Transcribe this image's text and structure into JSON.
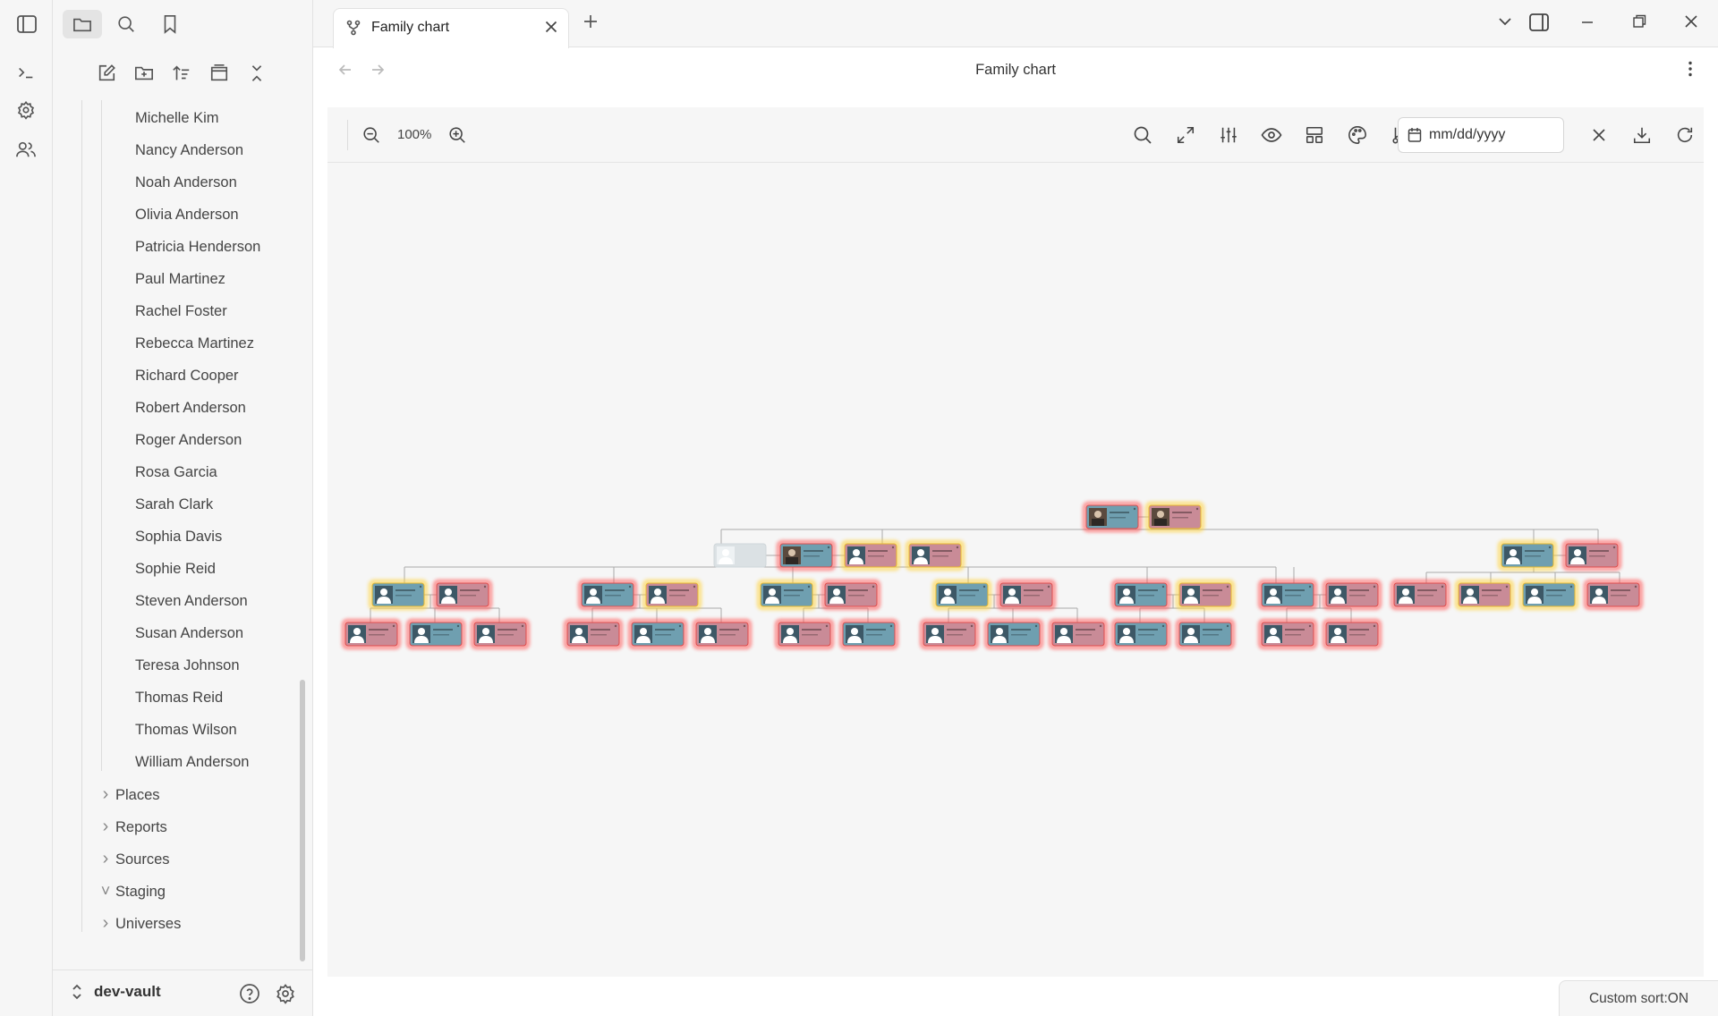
{
  "tab": {
    "title": "Family chart"
  },
  "view": {
    "title": "Family chart"
  },
  "toolbar": {
    "zoom": "100%",
    "date_placeholder": "mm/dd/yyyy"
  },
  "sidebar": {
    "people": [
      "Michelle Kim",
      "Nancy Anderson",
      "Noah Anderson",
      "Olivia Anderson",
      "Patricia Henderson",
      "Paul Martinez",
      "Rachel Foster",
      "Rebecca Martinez",
      "Richard Cooper",
      "Robert Anderson",
      "Roger Anderson",
      "Rosa Garcia",
      "Sarah Clark",
      "Sophia Davis",
      "Sophie Reid",
      "Steven Anderson",
      "Susan Anderson",
      "Teresa Johnson",
      "Thomas Reid",
      "Thomas Wilson",
      "William Anderson"
    ],
    "folders": [
      {
        "label": "Places",
        "expanded": false
      },
      {
        "label": "Reports",
        "expanded": false
      },
      {
        "label": "Sources",
        "expanded": false
      },
      {
        "label": "Staging",
        "expanded": true
      },
      {
        "label": "Universes",
        "expanded": false
      }
    ]
  },
  "vault": {
    "name": "dev-vault"
  },
  "status": {
    "sort": "Custom sort:ON"
  },
  "colors": {
    "male_card": "#6f9fb0",
    "female_card": "#c98b97",
    "glow_red": "#ff5a5a",
    "glow_yellow": "#ffd23c"
  },
  "tree_chart": {
    "generations": 4,
    "cards": [
      {
        "gen": 0,
        "gender": "male",
        "glow": "red",
        "photo": true
      },
      {
        "gen": 0,
        "gender": "female",
        "glow": "yellow",
        "photo": true
      },
      {
        "gen": 1,
        "gender": "placeholder",
        "glow": "none",
        "photo": false
      },
      {
        "gen": 1,
        "gender": "male",
        "glow": "red",
        "photo": true
      },
      {
        "gen": 1,
        "gender": "female",
        "glow": "yellow",
        "photo": false
      },
      {
        "gen": 1,
        "gender": "female",
        "glow": "yellow",
        "photo": false
      },
      {
        "gen": 1,
        "gender": "male",
        "glow": "yellow",
        "photo": false
      },
      {
        "gen": 1,
        "gender": "female",
        "glow": "red",
        "photo": false
      },
      {
        "gen": 2,
        "gender": "male",
        "glow": "yellow",
        "photo": false
      },
      {
        "gen": 2,
        "gender": "female",
        "glow": "red",
        "photo": false
      },
      {
        "gen": 2,
        "gender": "male",
        "glow": "red",
        "photo": false
      },
      {
        "gen": 2,
        "gender": "female",
        "glow": "yellow",
        "photo": false
      },
      {
        "gen": 2,
        "gender": "male",
        "glow": "yellow",
        "photo": false
      },
      {
        "gen": 2,
        "gender": "female",
        "glow": "red",
        "photo": false
      },
      {
        "gen": 2,
        "gender": "male",
        "glow": "yellow",
        "photo": false
      },
      {
        "gen": 2,
        "gender": "female",
        "glow": "red",
        "photo": false
      },
      {
        "gen": 2,
        "gender": "male",
        "glow": "red",
        "photo": false
      },
      {
        "gen": 2,
        "gender": "female",
        "glow": "yellow",
        "photo": false
      },
      {
        "gen": 2,
        "gender": "male",
        "glow": "red",
        "photo": false
      },
      {
        "gen": 2,
        "gender": "female",
        "glow": "red",
        "photo": false
      },
      {
        "gen": 2,
        "gender": "female",
        "glow": "red",
        "photo": false
      },
      {
        "gen": 2,
        "gender": "female",
        "glow": "yellow",
        "photo": false
      },
      {
        "gen": 2,
        "gender": "male",
        "glow": "yellow",
        "photo": false
      },
      {
        "gen": 2,
        "gender": "female",
        "glow": "red",
        "photo": false
      },
      {
        "gen": 3,
        "gender": "female",
        "glow": "red",
        "photo": false
      },
      {
        "gen": 3,
        "gender": "male",
        "glow": "red",
        "photo": false
      },
      {
        "gen": 3,
        "gender": "female",
        "glow": "red",
        "photo": false
      },
      {
        "gen": 3,
        "gender": "female",
        "glow": "red",
        "photo": false
      },
      {
        "gen": 3,
        "gender": "male",
        "glow": "red",
        "photo": false
      },
      {
        "gen": 3,
        "gender": "female",
        "glow": "red",
        "photo": false
      },
      {
        "gen": 3,
        "gender": "female",
        "glow": "red",
        "photo": false
      },
      {
        "gen": 3,
        "gender": "male",
        "glow": "red",
        "photo": false
      },
      {
        "gen": 3,
        "gender": "female",
        "glow": "red",
        "photo": false
      },
      {
        "gen": 3,
        "gender": "male",
        "glow": "red",
        "photo": false
      },
      {
        "gen": 3,
        "gender": "female",
        "glow": "red",
        "photo": false
      },
      {
        "gen": 3,
        "gender": "male",
        "glow": "red",
        "photo": false
      },
      {
        "gen": 3,
        "gender": "male",
        "glow": "red",
        "photo": false
      },
      {
        "gen": 3,
        "gender": "female",
        "glow": "red",
        "photo": false
      },
      {
        "gen": 3,
        "gender": "female",
        "glow": "red",
        "photo": false
      }
    ]
  }
}
